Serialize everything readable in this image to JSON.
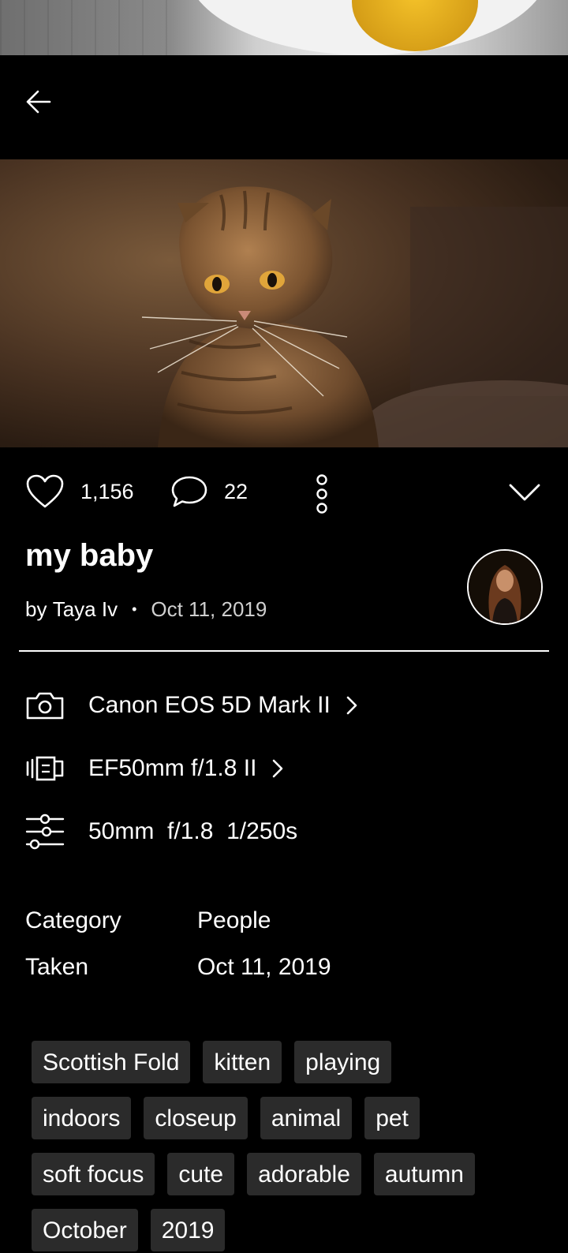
{
  "photo": {
    "title": "my baby",
    "byline_prefix": "by",
    "author": "Taya Iv",
    "separator": "•",
    "date": "Oct 11, 2019"
  },
  "actions": {
    "likes": "1,156",
    "comments": "22"
  },
  "exif": {
    "camera": "Canon EOS 5D Mark II",
    "lens": "EF50mm f/1.8 II",
    "settings": "50mm  f/1.8  1/250s"
  },
  "meta": [
    {
      "label": "Category",
      "value": "People"
    },
    {
      "label": "Taken",
      "value": "Oct 11, 2019"
    }
  ],
  "tags": [
    "Scottish Fold",
    "kitten",
    "playing",
    "indoors",
    "closeup",
    "animal",
    "pet",
    "soft focus",
    "cute",
    "adorable",
    "autumn",
    "October",
    "2019"
  ],
  "colors": {
    "background": "#000000",
    "text": "#ffffff",
    "tag_bg": "#2b2b2b"
  },
  "icons": [
    "back-arrow-icon",
    "heart-icon",
    "comment-icon",
    "more-vertical-icon",
    "chevron-down-icon",
    "camera-icon",
    "lens-icon",
    "settings-sliders-icon",
    "chevron-right-icon"
  ]
}
